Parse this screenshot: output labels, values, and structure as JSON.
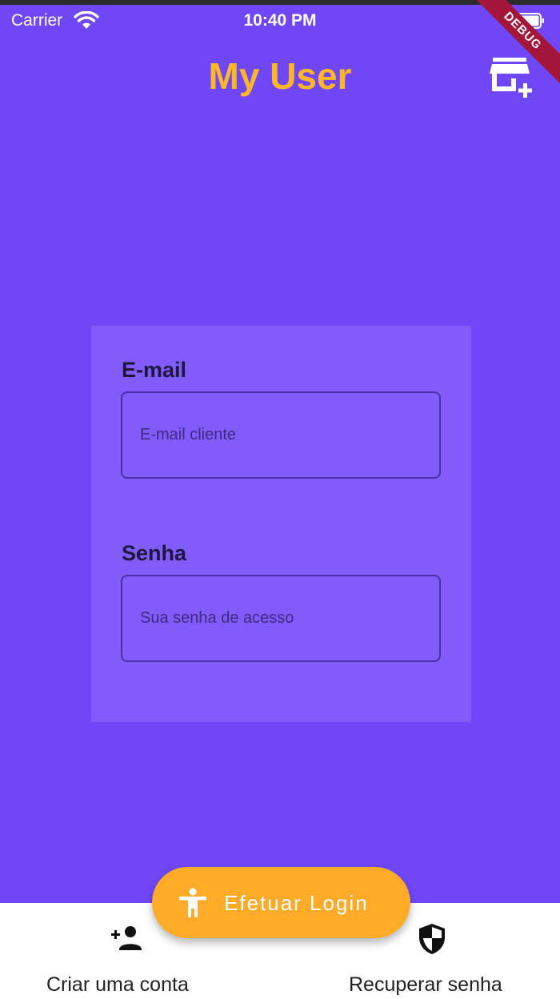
{
  "status_bar": {
    "carrier": "Carrier",
    "time": "10:40 PM"
  },
  "debug_banner": "DEBUG",
  "app_bar": {
    "title": "My User",
    "action_icon": "add-store-icon"
  },
  "form": {
    "email": {
      "label": "E-mail",
      "placeholder": "E-mail cliente",
      "value": ""
    },
    "password": {
      "label": "Senha",
      "placeholder": "Sua senha de acesso",
      "value": ""
    }
  },
  "fab": {
    "label": "Efetuar Login",
    "icon": "accessibility-icon"
  },
  "bottom_nav": [
    {
      "label": "Criar uma conta",
      "icon": "person-add-icon"
    },
    {
      "label": "Recuperar senha",
      "icon": "shield-icon"
    }
  ],
  "colors": {
    "background": "#6f47f7",
    "card": "#825cfb",
    "title": "#ffb72a",
    "fab": "#ffab2a",
    "debug": "#a3163a"
  }
}
